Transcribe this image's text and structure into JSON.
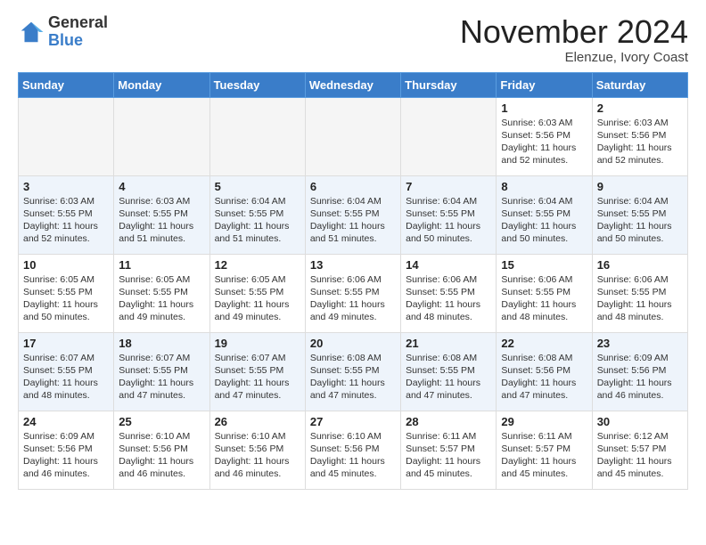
{
  "header": {
    "logo_general": "General",
    "logo_blue": "Blue",
    "month_title": "November 2024",
    "subtitle": "Elenzue, Ivory Coast"
  },
  "weekdays": [
    "Sunday",
    "Monday",
    "Tuesday",
    "Wednesday",
    "Thursday",
    "Friday",
    "Saturday"
  ],
  "weeks": [
    {
      "alt": false,
      "days": [
        {
          "num": "",
          "info": ""
        },
        {
          "num": "",
          "info": ""
        },
        {
          "num": "",
          "info": ""
        },
        {
          "num": "",
          "info": ""
        },
        {
          "num": "",
          "info": ""
        },
        {
          "num": "1",
          "info": "Sunrise: 6:03 AM\nSunset: 5:56 PM\nDaylight: 11 hours\nand 52 minutes."
        },
        {
          "num": "2",
          "info": "Sunrise: 6:03 AM\nSunset: 5:56 PM\nDaylight: 11 hours\nand 52 minutes."
        }
      ]
    },
    {
      "alt": true,
      "days": [
        {
          "num": "3",
          "info": "Sunrise: 6:03 AM\nSunset: 5:55 PM\nDaylight: 11 hours\nand 52 minutes."
        },
        {
          "num": "4",
          "info": "Sunrise: 6:03 AM\nSunset: 5:55 PM\nDaylight: 11 hours\nand 51 minutes."
        },
        {
          "num": "5",
          "info": "Sunrise: 6:04 AM\nSunset: 5:55 PM\nDaylight: 11 hours\nand 51 minutes."
        },
        {
          "num": "6",
          "info": "Sunrise: 6:04 AM\nSunset: 5:55 PM\nDaylight: 11 hours\nand 51 minutes."
        },
        {
          "num": "7",
          "info": "Sunrise: 6:04 AM\nSunset: 5:55 PM\nDaylight: 11 hours\nand 50 minutes."
        },
        {
          "num": "8",
          "info": "Sunrise: 6:04 AM\nSunset: 5:55 PM\nDaylight: 11 hours\nand 50 minutes."
        },
        {
          "num": "9",
          "info": "Sunrise: 6:04 AM\nSunset: 5:55 PM\nDaylight: 11 hours\nand 50 minutes."
        }
      ]
    },
    {
      "alt": false,
      "days": [
        {
          "num": "10",
          "info": "Sunrise: 6:05 AM\nSunset: 5:55 PM\nDaylight: 11 hours\nand 50 minutes."
        },
        {
          "num": "11",
          "info": "Sunrise: 6:05 AM\nSunset: 5:55 PM\nDaylight: 11 hours\nand 49 minutes."
        },
        {
          "num": "12",
          "info": "Sunrise: 6:05 AM\nSunset: 5:55 PM\nDaylight: 11 hours\nand 49 minutes."
        },
        {
          "num": "13",
          "info": "Sunrise: 6:06 AM\nSunset: 5:55 PM\nDaylight: 11 hours\nand 49 minutes."
        },
        {
          "num": "14",
          "info": "Sunrise: 6:06 AM\nSunset: 5:55 PM\nDaylight: 11 hours\nand 48 minutes."
        },
        {
          "num": "15",
          "info": "Sunrise: 6:06 AM\nSunset: 5:55 PM\nDaylight: 11 hours\nand 48 minutes."
        },
        {
          "num": "16",
          "info": "Sunrise: 6:06 AM\nSunset: 5:55 PM\nDaylight: 11 hours\nand 48 minutes."
        }
      ]
    },
    {
      "alt": true,
      "days": [
        {
          "num": "17",
          "info": "Sunrise: 6:07 AM\nSunset: 5:55 PM\nDaylight: 11 hours\nand 48 minutes."
        },
        {
          "num": "18",
          "info": "Sunrise: 6:07 AM\nSunset: 5:55 PM\nDaylight: 11 hours\nand 47 minutes."
        },
        {
          "num": "19",
          "info": "Sunrise: 6:07 AM\nSunset: 5:55 PM\nDaylight: 11 hours\nand 47 minutes."
        },
        {
          "num": "20",
          "info": "Sunrise: 6:08 AM\nSunset: 5:55 PM\nDaylight: 11 hours\nand 47 minutes."
        },
        {
          "num": "21",
          "info": "Sunrise: 6:08 AM\nSunset: 5:55 PM\nDaylight: 11 hours\nand 47 minutes."
        },
        {
          "num": "22",
          "info": "Sunrise: 6:08 AM\nSunset: 5:56 PM\nDaylight: 11 hours\nand 47 minutes."
        },
        {
          "num": "23",
          "info": "Sunrise: 6:09 AM\nSunset: 5:56 PM\nDaylight: 11 hours\nand 46 minutes."
        }
      ]
    },
    {
      "alt": false,
      "days": [
        {
          "num": "24",
          "info": "Sunrise: 6:09 AM\nSunset: 5:56 PM\nDaylight: 11 hours\nand 46 minutes."
        },
        {
          "num": "25",
          "info": "Sunrise: 6:10 AM\nSunset: 5:56 PM\nDaylight: 11 hours\nand 46 minutes."
        },
        {
          "num": "26",
          "info": "Sunrise: 6:10 AM\nSunset: 5:56 PM\nDaylight: 11 hours\nand 46 minutes."
        },
        {
          "num": "27",
          "info": "Sunrise: 6:10 AM\nSunset: 5:56 PM\nDaylight: 11 hours\nand 45 minutes."
        },
        {
          "num": "28",
          "info": "Sunrise: 6:11 AM\nSunset: 5:57 PM\nDaylight: 11 hours\nand 45 minutes."
        },
        {
          "num": "29",
          "info": "Sunrise: 6:11 AM\nSunset: 5:57 PM\nDaylight: 11 hours\nand 45 minutes."
        },
        {
          "num": "30",
          "info": "Sunrise: 6:12 AM\nSunset: 5:57 PM\nDaylight: 11 hours\nand 45 minutes."
        }
      ]
    }
  ]
}
